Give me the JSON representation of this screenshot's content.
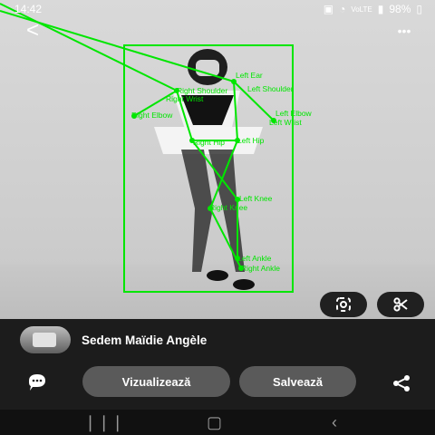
{
  "status": {
    "time": "14:42",
    "battery": "98%",
    "icons": [
      "camera-icon",
      "wifi-icon",
      "volte-icon",
      "signal-icon",
      "battery-icon"
    ]
  },
  "topbar": {
    "back_label": "<",
    "more_label": "•••"
  },
  "overlay": {
    "labels": {
      "left_ear": "Left Ear",
      "left_shoulder": "Left Shoulder",
      "right_shoulder": "Right Shoulder",
      "right_wrist": "Right Wrist",
      "right_elbow": "Right Elbow",
      "left_elbow": "Left Elbow",
      "left_wrist": "Left Wrist",
      "right_hip": "Right Hip",
      "left_hip": "Left Hip",
      "left_knee": "Left Knee",
      "right_knee": "Right Knee",
      "left_ankle": "Left Ankle",
      "right_ankle": "Right Ankle"
    }
  },
  "profile": {
    "name": "Sedem Maïdie Angèle"
  },
  "actions": {
    "view_label": "Vizualizează",
    "save_label": "Salvează"
  },
  "colors": {
    "overlay": "#00e600",
    "sheet": "#1c1c1c",
    "pill": "#5a5a5a"
  }
}
